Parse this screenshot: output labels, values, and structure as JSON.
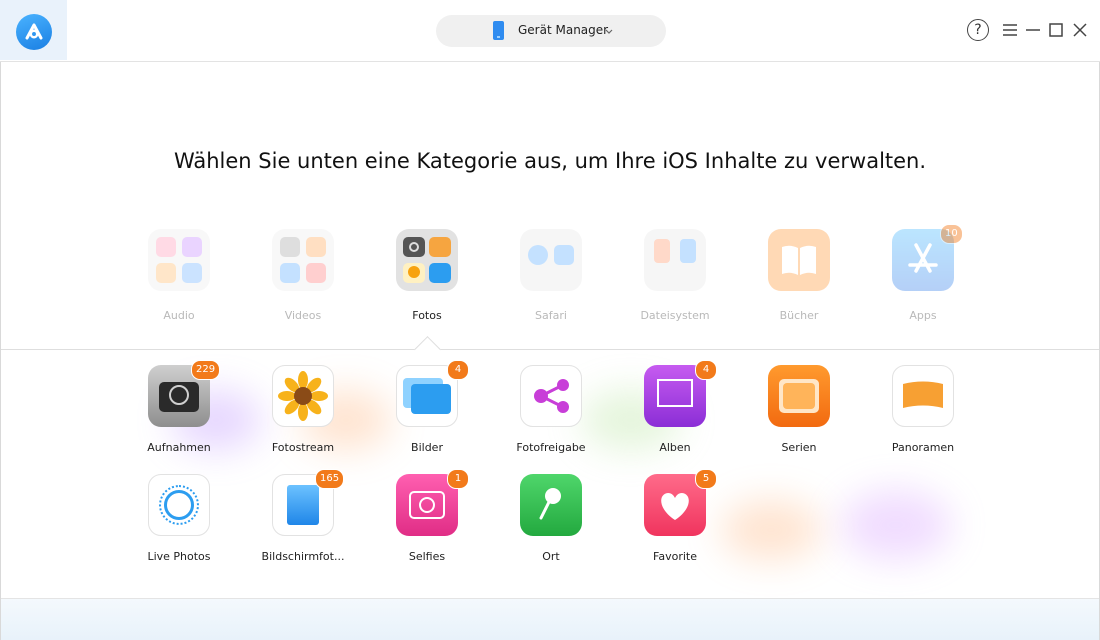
{
  "app": {
    "logo_icon": "anytrans-logo-icon"
  },
  "device_selector": {
    "label": "Gerät Manager",
    "icon": "iphone-icon",
    "chevron": "chevron-down-icon"
  },
  "window_controls": {
    "help": "?",
    "icons": [
      "help-icon",
      "menu-icon",
      "minimize-icon",
      "maximize-icon",
      "close-icon"
    ]
  },
  "heading": "Wählen Sie unten eine Kategorie aus, um Ihre iOS Inhalte zu verwalten.",
  "categories": [
    {
      "label": "Audio",
      "active": false
    },
    {
      "label": "Videos",
      "active": false
    },
    {
      "label": "Fotos",
      "active": true
    },
    {
      "label": "Safari",
      "active": false
    },
    {
      "label": "Dateisystem",
      "active": false
    },
    {
      "label": "Bücher",
      "active": false
    },
    {
      "label": "Apps",
      "active": false,
      "badge": "10"
    }
  ],
  "photo_tiles": [
    {
      "label": "Aufnahmen",
      "badge": "229"
    },
    {
      "label": "Fotostream"
    },
    {
      "label": "Bilder",
      "badge": "4"
    },
    {
      "label": "Fotofreigabe"
    },
    {
      "label": "Alben",
      "badge": "4"
    },
    {
      "label": "Serien"
    },
    {
      "label": "Panoramen"
    },
    {
      "label": "Live Photos"
    },
    {
      "label": "Bildschirmfot...",
      "badge": "165"
    },
    {
      "label": "Selfies",
      "badge": "1"
    },
    {
      "label": "Ort"
    },
    {
      "label": "Favorite",
      "badge": "5"
    }
  ],
  "colors": {
    "accent": "#2f8cf0",
    "badge": "#f27a1a"
  }
}
